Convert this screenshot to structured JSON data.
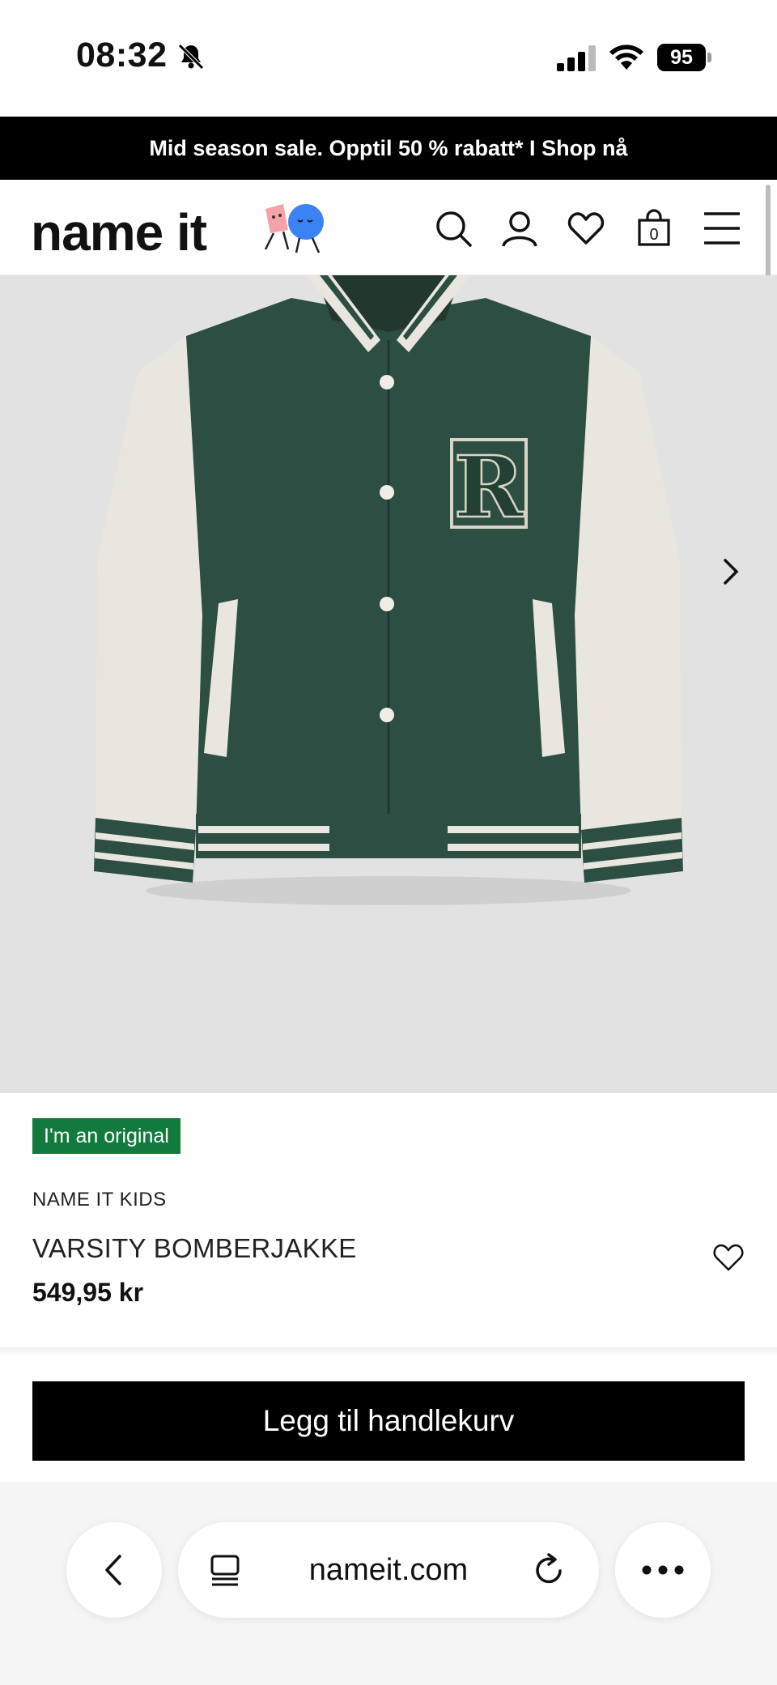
{
  "status_bar": {
    "time": "08:32",
    "battery": "95",
    "icons": [
      "bell-slash-icon",
      "signal-icon",
      "wifi-icon",
      "battery-icon"
    ]
  },
  "promo": {
    "text": "Mid season sale. Opptil 50 % rabatt* I Shop nå"
  },
  "header": {
    "logo_text": "name it",
    "cart_count": "0",
    "icons": [
      "search-icon",
      "account-icon",
      "heart-icon",
      "bag-icon",
      "menu-icon"
    ]
  },
  "product": {
    "badge": "I'm an original",
    "brand": "NAME IT KIDS",
    "name": "VARSITY BOMBERJAKKE",
    "price": "549,95 kr",
    "image_letter": "R",
    "colors": {
      "body": "#2d4e42",
      "sleeves": "#e8e6de",
      "badge_bg": "#127a3d",
      "image_bg": "#e2e2e2"
    }
  },
  "actions": {
    "add_to_cart": "Legg til handlekurv"
  },
  "browser": {
    "url": "nameit.com",
    "icons": [
      "back-icon",
      "tabs-icon",
      "reload-icon",
      "more-icon"
    ]
  }
}
